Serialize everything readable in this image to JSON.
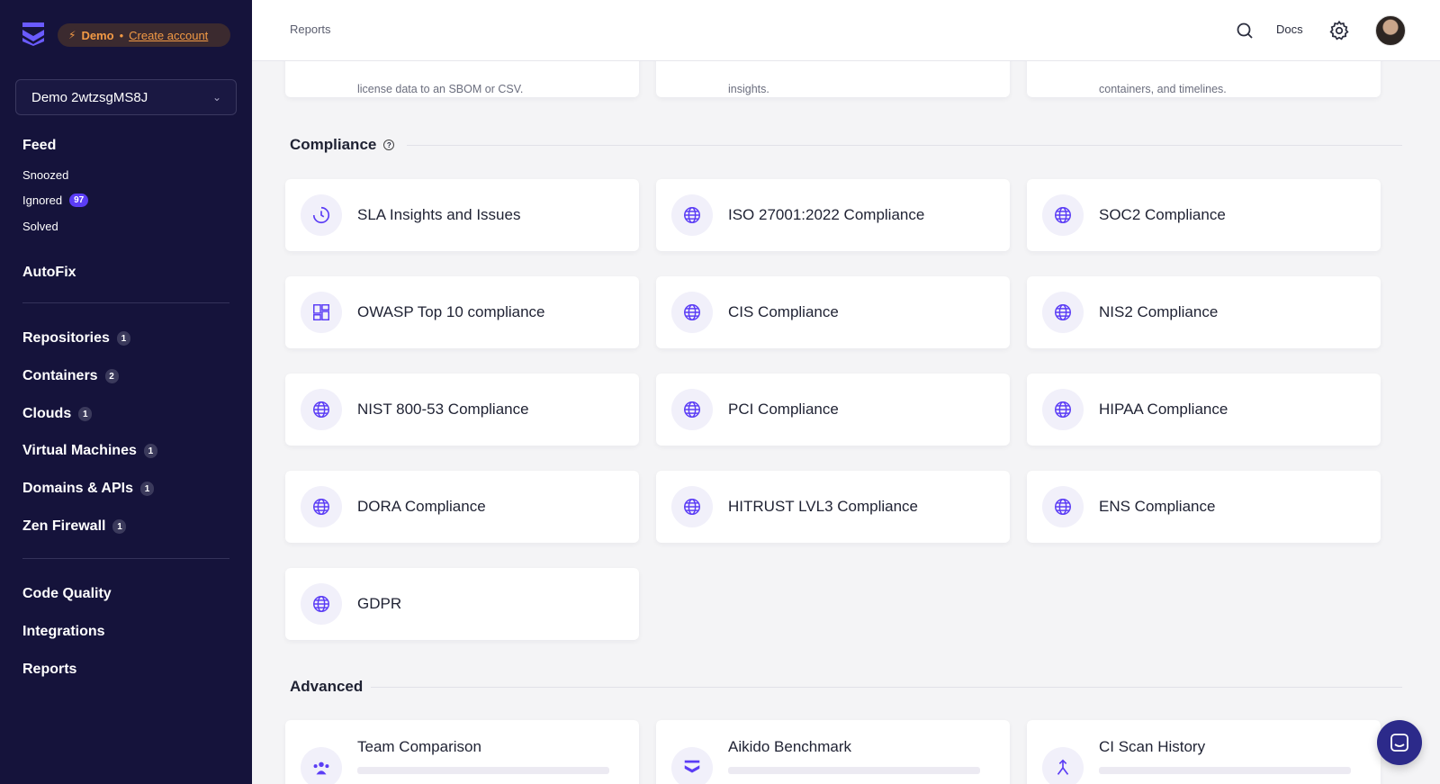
{
  "sidebar": {
    "demo_label": "Demo",
    "create_account": "Create account",
    "workspace": "Demo 2wtzsgMS8J",
    "feed": "Feed",
    "snoozed": "Snoozed",
    "ignored": "Ignored",
    "ignored_count": "97",
    "solved": "Solved",
    "autofix": "AutoFix",
    "items": [
      {
        "label": "Repositories",
        "count": "1"
      },
      {
        "label": "Containers",
        "count": "2"
      },
      {
        "label": "Clouds",
        "count": "1"
      },
      {
        "label": "Virtual Machines",
        "count": "1"
      },
      {
        "label": "Domains & APIs",
        "count": "1"
      },
      {
        "label": "Zen Firewall",
        "count": "1"
      }
    ],
    "code_quality": "Code Quality",
    "integrations": "Integrations",
    "reports": "Reports"
  },
  "header": {
    "breadcrumb": "Reports",
    "docs": "Docs"
  },
  "top_partial": [
    "license data to an SBOM or CSV.",
    "insights.",
    "containers, and timelines."
  ],
  "compliance": {
    "title": "Compliance",
    "cards": [
      {
        "title": "SLA Insights and Issues",
        "icon": "clock-icon"
      },
      {
        "title": "ISO 27001:2022 Compliance",
        "icon": "globe-icon"
      },
      {
        "title": "SOC2 Compliance",
        "icon": "globe-icon"
      },
      {
        "title": "OWASP Top 10 compliance",
        "icon": "layout-icon"
      },
      {
        "title": "CIS Compliance",
        "icon": "globe-icon"
      },
      {
        "title": "NIS2 Compliance",
        "icon": "globe-icon"
      },
      {
        "title": "NIST 800-53 Compliance",
        "icon": "globe-icon"
      },
      {
        "title": "PCI Compliance",
        "icon": "globe-icon"
      },
      {
        "title": "HIPAA Compliance",
        "icon": "globe-icon"
      },
      {
        "title": "DORA Compliance",
        "icon": "globe-icon"
      },
      {
        "title": "HITRUST LVL3 Compliance",
        "icon": "globe-icon"
      },
      {
        "title": "ENS Compliance",
        "icon": "globe-icon"
      },
      {
        "title": "GDPR",
        "icon": "globe-icon"
      }
    ]
  },
  "advanced": {
    "title": "Advanced",
    "cards": [
      {
        "title": "Team Comparison",
        "icon": "team-icon"
      },
      {
        "title": "Aikido Benchmark",
        "icon": "benchmark-icon"
      },
      {
        "title": "CI Scan History",
        "icon": "merge-icon"
      }
    ]
  },
  "colors": {
    "sidebar_bg": "#15133b",
    "accent": "#5b3df5",
    "demo_orange": "#f39a45"
  }
}
